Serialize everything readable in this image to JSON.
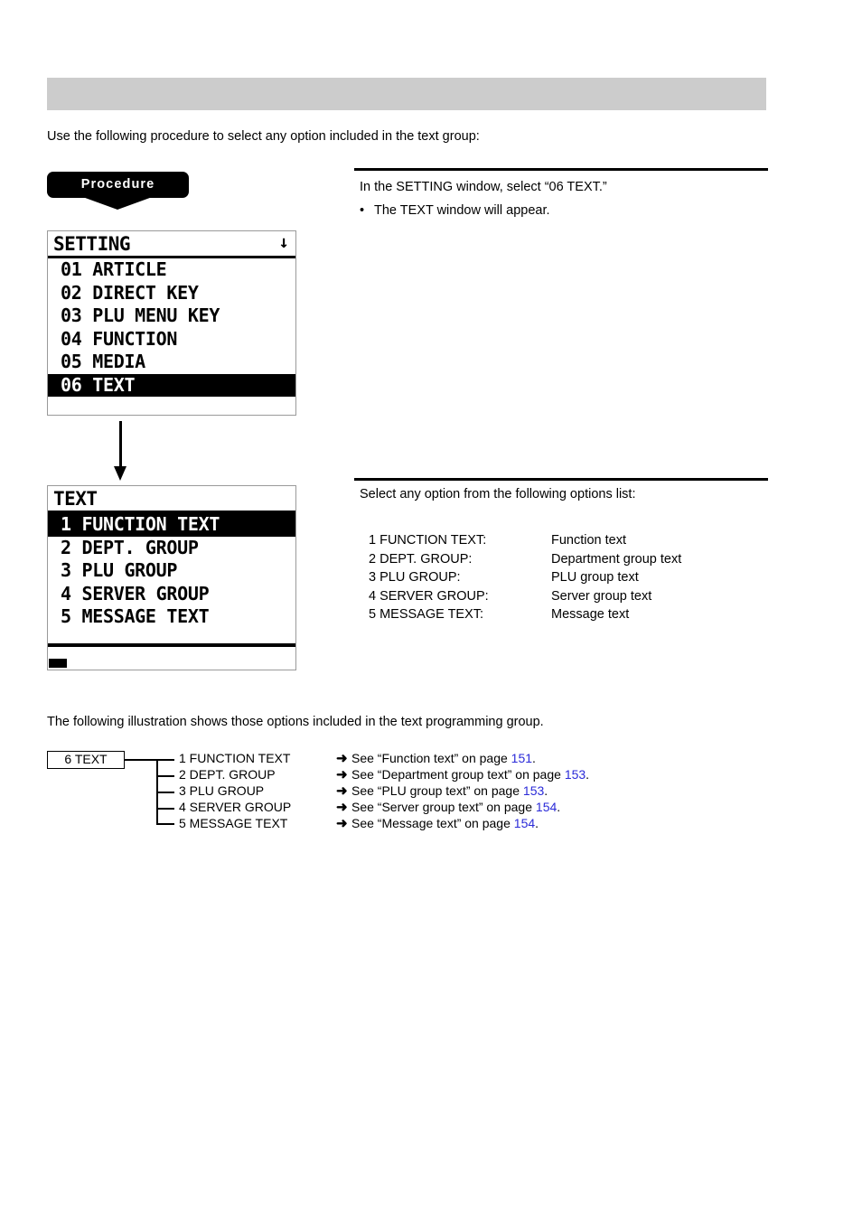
{
  "header": {
    "band_title": "",
    "band_color": "#cccccc"
  },
  "intro": "Use the following procedure to select any option included in the text group:",
  "procedure_badge": {
    "label": "Procedure"
  },
  "steps": [
    {
      "main": "In the SETTING window, select “06 TEXT.”",
      "bullet_dot": "•",
      "bullet": "The TEXT window will appear."
    },
    {
      "main": "Select any option from the following options list:"
    }
  ],
  "options_table": {
    "rows": [
      {
        "key": "1 FUNCTION TEXT:",
        "value": "Function text"
      },
      {
        "key": "2 DEPT. GROUP:",
        "value": "Department group text"
      },
      {
        "key": "3 PLU GROUP:",
        "value": "PLU group text"
      },
      {
        "key": "4 SERVER GROUP:",
        "value": "Server group text"
      },
      {
        "key": "5 MESSAGE TEXT:",
        "value": "Message text"
      }
    ]
  },
  "lcd_setting": {
    "title": "SETTING",
    "scroll_indicator": "↓",
    "rows": [
      {
        "label": "01 ARTICLE",
        "selected": false
      },
      {
        "label": "02 DIRECT KEY",
        "selected": false
      },
      {
        "label": "03 PLU MENU KEY",
        "selected": false
      },
      {
        "label": "04 FUNCTION",
        "selected": false
      },
      {
        "label": "05 MEDIA",
        "selected": false
      },
      {
        "label": "06 TEXT",
        "selected": true
      }
    ]
  },
  "lcd_text": {
    "title": "TEXT",
    "scroll_indicator": "",
    "rows": [
      {
        "label": "1 FUNCTION TEXT",
        "selected": true
      },
      {
        "label": "2 DEPT. GROUP",
        "selected": false
      },
      {
        "label": "3 PLU GROUP",
        "selected": false
      },
      {
        "label": "4 SERVER GROUP",
        "selected": false
      },
      {
        "label": "5 MESSAGE TEXT",
        "selected": false
      }
    ]
  },
  "illustration_intro": "The following illustration shows those options included in the text programming group.",
  "tree": {
    "root_label": "6 TEXT",
    "items": [
      {
        "label": "1 FUNCTION TEXT",
        "arrow": "➜",
        "see_prefix": "See “Function text” on page ",
        "page": "151",
        "period": "."
      },
      {
        "label": "2 DEPT. GROUP",
        "arrow": "➜",
        "see_prefix": "See “Department group text” on page ",
        "page": "153",
        "period": "."
      },
      {
        "label": "3 PLU GROUP",
        "arrow": "➜",
        "see_prefix": "See “PLU group text” on page ",
        "page": "153",
        "period": "."
      },
      {
        "label": "4 SERVER GROUP",
        "arrow": "➜",
        "see_prefix": "See “Server group text” on page ",
        "page": "154",
        "period": "."
      },
      {
        "label": "5 MESSAGE TEXT",
        "arrow": "➜",
        "see_prefix": "See “Message text” on page ",
        "page": "154",
        "period": "."
      }
    ]
  },
  "colors": {
    "link": "#2a2ad8",
    "band": "#cccccc",
    "ink": "#000000"
  }
}
